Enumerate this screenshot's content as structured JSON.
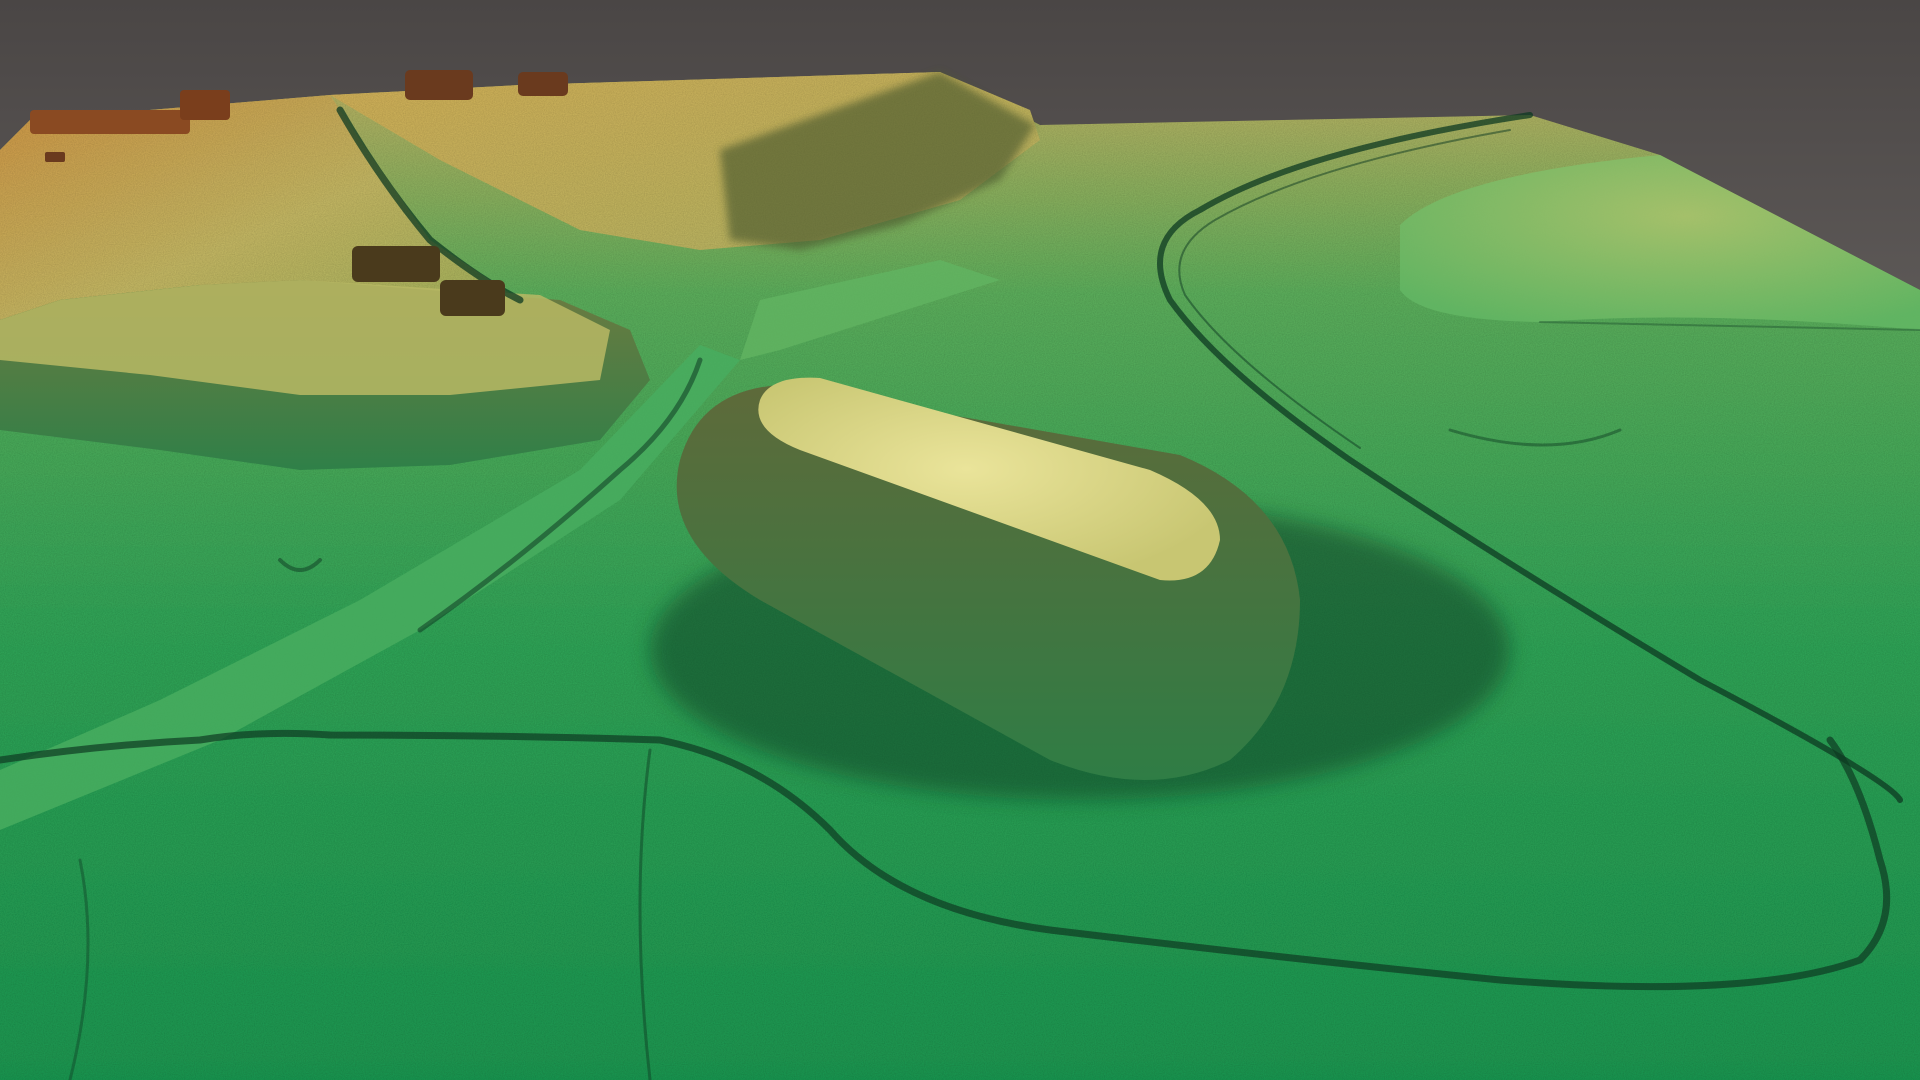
{
  "colors": {
    "sky_top": "#4a4645",
    "sky_bottom": "#8c8784",
    "terrain_low": "#22a056",
    "terrain_mid": "#4cb45e",
    "terrain_high": "#c9c06a",
    "terrain_peak": "#d4a84e",
    "shadow": "#0e3a22",
    "building": "#8a4a22"
  },
  "scene": {
    "features": [
      "sky-backdrop",
      "terrain-surface",
      "oval-mound",
      "left-plateau",
      "upper-ridge",
      "far-right-hill",
      "central-road",
      "ditch-channels",
      "farm-buildings"
    ]
  }
}
